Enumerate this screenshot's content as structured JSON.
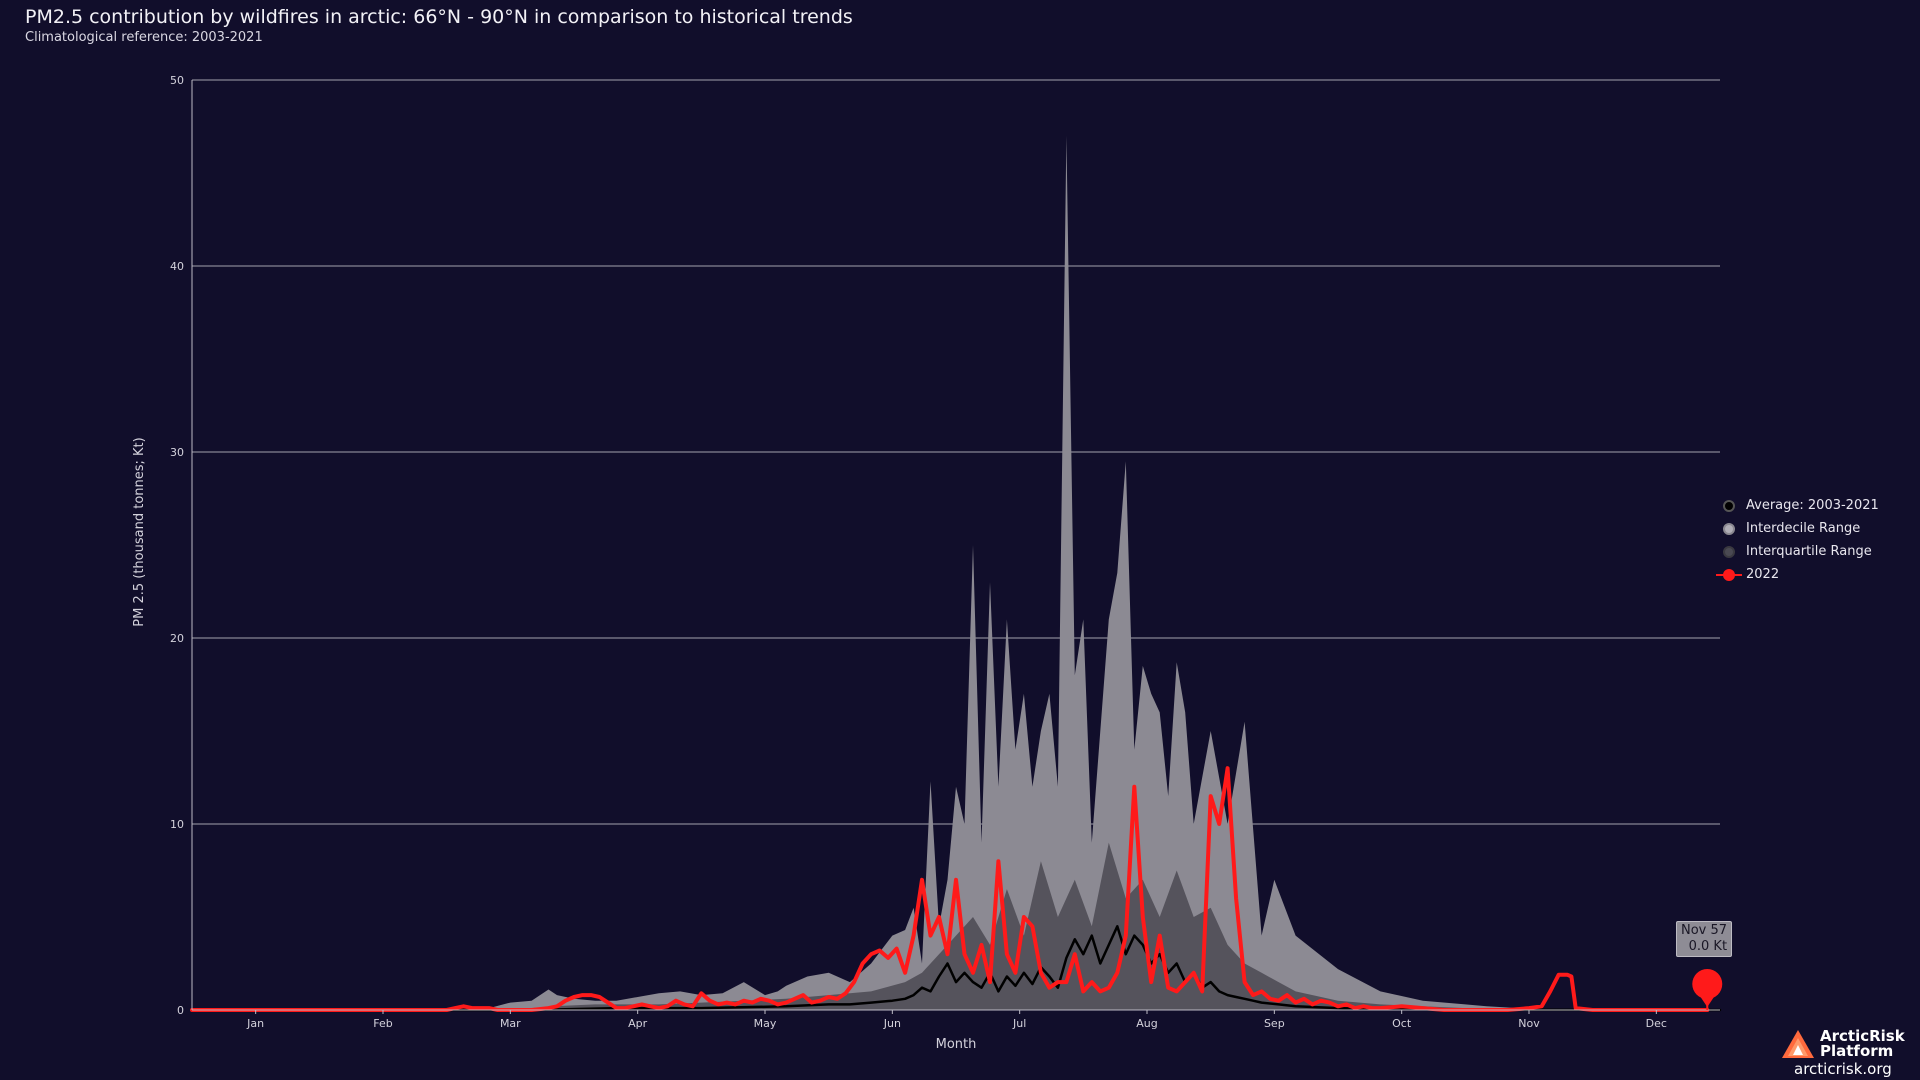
{
  "header": {
    "title": "PM2.5 contribution by wildfires in arctic: 66°N - 90°N  in comparison to historical trends",
    "subtitle": "Climatological reference: 2003-2021"
  },
  "legend": {
    "items": [
      {
        "label": "Average: 2003-2021",
        "symbol": "dot",
        "color": "#000000",
        "border": "#555555"
      },
      {
        "label": "Interdecile Range",
        "symbol": "dot",
        "color": "#b0aeb6",
        "border": "#8a8890"
      },
      {
        "label": "Interquartile Range",
        "symbol": "dot",
        "color": "#4a4952",
        "border": "#3a3940"
      },
      {
        "label": "2022",
        "symbol": "line-dot",
        "color": "#ff1a1a",
        "border": "#ff1a1a"
      }
    ]
  },
  "tooltip": {
    "date": "Nov 57",
    "value": "0.0 Kt"
  },
  "branding": {
    "name_line1": "ArcticRisk",
    "name_line2": "Platform",
    "url": "arcticrisk.org"
  },
  "colors": {
    "background": "#110e2b",
    "interdecile": "#8c8a93",
    "interquartile": "#55535c",
    "average": "#000000",
    "current": "#ff1a1a",
    "grid": "#bdbbc6"
  },
  "chart_data": {
    "type": "area",
    "title": "PM2.5 contribution by wildfires in arctic: 66°N - 90°N  in comparison to historical trends",
    "subtitle": "Climatological reference: 2003-2021",
    "xlabel": "Month",
    "ylabel": "PM 2.5 (thousand tonnes; Kt)",
    "xticks": [
      "Jan",
      "Feb",
      "Mar",
      "Apr",
      "May",
      "Jun",
      "Jul",
      "Aug",
      "Sep",
      "Oct",
      "Nov",
      "Dec"
    ],
    "xlim": [
      0,
      360
    ],
    "ylim": [
      0,
      50
    ],
    "yticks": [
      0,
      10,
      20,
      30,
      40,
      50
    ],
    "grid": true,
    "legend_position": "right",
    "x_unit": "day of year",
    "series": [
      {
        "name": "Interdecile Range",
        "kind": "band",
        "x": [
          0,
          60,
          70,
          75,
          80,
          84,
          86,
          90,
          95,
          100,
          105,
          110,
          115,
          120,
          125,
          130,
          135,
          138,
          140,
          145,
          150,
          155,
          160,
          165,
          168,
          170,
          172,
          174,
          176,
          178,
          180,
          182,
          184,
          186,
          188,
          190,
          192,
          194,
          196,
          198,
          200,
          202,
          204,
          206,
          208,
          210,
          212,
          214,
          216,
          218,
          220,
          222,
          224,
          226,
          228,
          230,
          232,
          234,
          236,
          240,
          244,
          248,
          252,
          255,
          260,
          270,
          280,
          290,
          300,
          305,
          320,
          360
        ],
        "high": [
          0,
          0,
          0.1,
          0.4,
          0.5,
          1.1,
          0.8,
          0.6,
          0.5,
          0.5,
          0.7,
          0.9,
          1.0,
          0.8,
          0.9,
          1.5,
          0.8,
          1.0,
          1.3,
          1.8,
          2.0,
          1.5,
          2.5,
          4.0,
          4.3,
          5.5,
          2.5,
          12.3,
          4.5,
          7.0,
          12.0,
          10.0,
          25.0,
          9.0,
          23.0,
          12.0,
          21.0,
          14.0,
          17.0,
          12.0,
          15.0,
          17.0,
          12.0,
          47.0,
          18.0,
          21.0,
          9.0,
          15.0,
          21.0,
          23.5,
          29.5,
          14.0,
          18.5,
          17.0,
          16.0,
          11.5,
          18.7,
          16.0,
          10.0,
          15.0,
          10.0,
          15.5,
          4.0,
          7.0,
          4.0,
          2.2,
          1.0,
          0.5,
          0.3,
          0.2,
          0,
          0
        ],
        "low": [
          0,
          0,
          0,
          0,
          0,
          0,
          0,
          0,
          0,
          0,
          0,
          0,
          0,
          0,
          0,
          0,
          0,
          0,
          0,
          0,
          0,
          0,
          0,
          0,
          0,
          0,
          0,
          0,
          0,
          0,
          0,
          0,
          0,
          0,
          0,
          0,
          0,
          0,
          0,
          0,
          0,
          0,
          0,
          0,
          0,
          0,
          0,
          0,
          0,
          0,
          0,
          0,
          0,
          0,
          0,
          0,
          0,
          0,
          0,
          0,
          0,
          0,
          0,
          0,
          0,
          0,
          0,
          0,
          0,
          0,
          0,
          0
        ]
      },
      {
        "name": "Interquartile Range",
        "kind": "band",
        "x": [
          0,
          75,
          85,
          95,
          110,
          120,
          130,
          140,
          150,
          160,
          168,
          172,
          176,
          180,
          184,
          188,
          192,
          196,
          200,
          204,
          208,
          212,
          216,
          220,
          224,
          228,
          232,
          236,
          240,
          244,
          248,
          252,
          256,
          260,
          270,
          280,
          290,
          300,
          360
        ],
        "high": [
          0,
          0,
          0.2,
          0.3,
          0.3,
          0.4,
          0.5,
          0.6,
          0.8,
          1.0,
          1.5,
          2.0,
          3.0,
          4.0,
          5.0,
          3.5,
          6.5,
          4.0,
          8.0,
          5.0,
          7.0,
          4.5,
          9.0,
          6.0,
          7.0,
          5.0,
          7.5,
          5.0,
          5.5,
          3.5,
          2.5,
          2.0,
          1.5,
          1.0,
          0.5,
          0.3,
          0.2,
          0.1,
          0
        ],
        "low": [
          0,
          0,
          0,
          0,
          0,
          0,
          0,
          0,
          0,
          0,
          0,
          0,
          0,
          0,
          0,
          0,
          0,
          0,
          0,
          0,
          0,
          0,
          0,
          0,
          0,
          0,
          0,
          0,
          0,
          0,
          0,
          0,
          0,
          0,
          0,
          0,
          0,
          0,
          0
        ]
      },
      {
        "name": "Average: 2003-2021",
        "kind": "line",
        "x": [
          0,
          80,
          100,
          120,
          140,
          150,
          155,
          160,
          165,
          168,
          170,
          172,
          174,
          176,
          178,
          180,
          182,
          184,
          186,
          188,
          190,
          192,
          194,
          196,
          198,
          200,
          202,
          204,
          206,
          208,
          210,
          212,
          214,
          216,
          218,
          220,
          222,
          224,
          226,
          228,
          230,
          232,
          234,
          236,
          238,
          240,
          242,
          244,
          246,
          248,
          250,
          252,
          256,
          260,
          270,
          280,
          300,
          360
        ],
        "y": [
          0,
          0,
          0.1,
          0.1,
          0.2,
          0.3,
          0.3,
          0.4,
          0.5,
          0.6,
          0.8,
          1.2,
          1.0,
          1.8,
          2.5,
          1.5,
          2.0,
          1.5,
          1.2,
          2.0,
          1.0,
          1.8,
          1.3,
          2.0,
          1.4,
          2.3,
          1.8,
          1.2,
          2.8,
          3.8,
          3.0,
          4.0,
          2.5,
          3.5,
          4.5,
          3.0,
          4.0,
          3.5,
          2.5,
          3.0,
          2.0,
          2.5,
          1.5,
          2.0,
          1.2,
          1.5,
          1.0,
          0.8,
          0.7,
          0.6,
          0.5,
          0.4,
          0.3,
          0.2,
          0.1,
          0.05,
          0.02,
          0
        ]
      },
      {
        "name": "2022",
        "kind": "line",
        "x": [
          0,
          60,
          62,
          64,
          66,
          68,
          70,
          72,
          74,
          80,
          84,
          86,
          88,
          90,
          92,
          94,
          96,
          98,
          100,
          102,
          104,
          106,
          108,
          110,
          112,
          114,
          116,
          118,
          120,
          122,
          124,
          126,
          128,
          130,
          132,
          134,
          136,
          138,
          140,
          142,
          144,
          146,
          148,
          150,
          152,
          154,
          156,
          158,
          160,
          162,
          164,
          166,
          168,
          170,
          172,
          174,
          176,
          178,
          180,
          182,
          184,
          186,
          188,
          190,
          192,
          194,
          196,
          198,
          200,
          202,
          204,
          206,
          208,
          210,
          212,
          214,
          216,
          218,
          220,
          222,
          224,
          226,
          228,
          230,
          232,
          234,
          236,
          238,
          240,
          242,
          244,
          246,
          248,
          250,
          252,
          254,
          256,
          258,
          260,
          262,
          264,
          266,
          268,
          270,
          272,
          274,
          276,
          278,
          280,
          285,
          290,
          295,
          300,
          305,
          310,
          315,
          318,
          320,
          322,
          323,
          324,
          325,
          326,
          330,
          335,
          340,
          345,
          350,
          355,
          357
        ],
        "y": [
          0,
          0,
          0.1,
          0.2,
          0.1,
          0.1,
          0.1,
          0,
          0,
          0,
          0.1,
          0.2,
          0.5,
          0.7,
          0.8,
          0.8,
          0.7,
          0.4,
          0.1,
          0.1,
          0.2,
          0.3,
          0.2,
          0.1,
          0.2,
          0.5,
          0.3,
          0.2,
          0.9,
          0.5,
          0.3,
          0.4,
          0.3,
          0.5,
          0.4,
          0.6,
          0.5,
          0.3,
          0.4,
          0.6,
          0.8,
          0.4,
          0.5,
          0.7,
          0.6,
          0.9,
          1.5,
          2.5,
          3.0,
          3.2,
          2.8,
          3.3,
          2.0,
          4.0,
          7.0,
          4.0,
          5.0,
          3.0,
          7.0,
          3.0,
          2.0,
          3.5,
          1.5,
          8.0,
          3.0,
          2.0,
          5.0,
          4.5,
          2.0,
          1.2,
          1.5,
          1.5,
          3.0,
          1.0,
          1.5,
          1.0,
          1.2,
          2.0,
          4.0,
          12.0,
          5.0,
          1.5,
          4.0,
          1.2,
          1.0,
          1.5,
          2.0,
          1.0,
          11.5,
          10.0,
          13.0,
          6.0,
          1.5,
          0.8,
          1.0,
          0.6,
          0.5,
          0.8,
          0.4,
          0.6,
          0.3,
          0.5,
          0.4,
          0.2,
          0.3,
          0.1,
          0.2,
          0.1,
          0.1,
          0.2,
          0.1,
          0,
          0,
          0,
          0,
          0.1,
          0.2,
          1.0,
          1.9,
          1.9,
          1.9,
          1.8,
          0.1,
          0,
          0,
          0,
          0,
          0,
          0,
          0
        ]
      }
    ]
  }
}
